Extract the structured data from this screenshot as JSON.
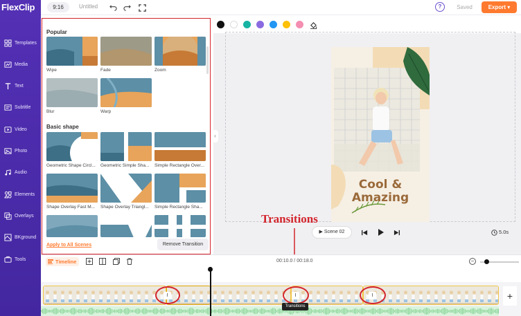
{
  "app": {
    "logo": "FlexClip"
  },
  "sidebar": {
    "items": [
      {
        "label": "Templates",
        "icon": "templates-icon"
      },
      {
        "label": "Media",
        "icon": "media-icon"
      },
      {
        "label": "Text",
        "icon": "text-icon"
      },
      {
        "label": "Subtitle",
        "icon": "subtitle-icon"
      },
      {
        "label": "Video",
        "icon": "video-icon"
      },
      {
        "label": "Photo",
        "icon": "photo-icon"
      },
      {
        "label": "Audio",
        "icon": "audio-icon"
      },
      {
        "label": "Elements",
        "icon": "elements-icon"
      },
      {
        "label": "Overlays",
        "icon": "overlays-icon"
      },
      {
        "label": "BKground",
        "icon": "background-icon"
      },
      {
        "label": "Tools",
        "icon": "tools-icon"
      }
    ]
  },
  "topbar": {
    "ratio": "9:16",
    "title": "Untitled",
    "help": "?",
    "saved": "Saved",
    "export": "Export ▾"
  },
  "panel": {
    "popular_title": "Popular",
    "popular": [
      "Wipe",
      "Fade",
      "Zoom",
      "Blur",
      "Warp"
    ],
    "basic_title": "Basic shape",
    "basic": [
      "Geometric Shape Circl...",
      "Geometric Simple Sha...",
      "Simple Rectangle Over...",
      "Shape Overlay Fast M...",
      "Shape Overlay Triangl...",
      "Simple Rectangle Sha..."
    ],
    "apply_all": "Apply to All Scenes",
    "remove": "Remove Transition"
  },
  "colors": [
    "#111111",
    "#ffffff",
    "#17b3a3",
    "#8a6be0",
    "#2196f3",
    "#ffc107",
    "#f48fb1"
  ],
  "preview": {
    "headline1": "Cool &",
    "headline2": "Amazing"
  },
  "playback": {
    "scene": "Scene 02",
    "duration": "5.0s"
  },
  "annotation": "Transitions",
  "timeline": {
    "toggle": "Timeline",
    "time": "00:10.0 / 00:18.0",
    "tooltip": "Transitions",
    "transition_badge": "I",
    "add": "+"
  }
}
